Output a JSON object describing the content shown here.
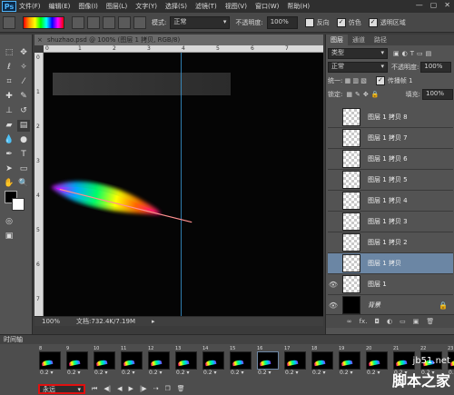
{
  "app": {
    "logo": "Ps"
  },
  "menu": [
    "文件(F)",
    "编辑(E)",
    "图像(I)",
    "图层(L)",
    "文字(Y)",
    "选择(S)",
    "滤镜(T)",
    "视图(V)",
    "窗口(W)",
    "帮助(H)"
  ],
  "window_controls": [
    "—",
    "▢",
    "✕"
  ],
  "options": {
    "mode_label": "模式:",
    "mode_value": "正常",
    "opacity_label": "不透明度:",
    "opacity_value": "100%",
    "reverse_label": "反向",
    "dither_label": "仿色",
    "transparency_label": "透明区域"
  },
  "document": {
    "title": "shuzhao.psd @ 100% (图层 1 拷贝, RGB/8)",
    "zoom": "100%",
    "doc_info": "文档:732.4K/7.19M",
    "ruler_top": [
      "0",
      "1",
      "2",
      "3",
      "4",
      "5",
      "6",
      "7"
    ],
    "ruler_left": [
      "0",
      "1",
      "2",
      "3",
      "4",
      "5",
      "6",
      "7"
    ]
  },
  "layers_panel": {
    "tabs": [
      "图层",
      "通道",
      "路径"
    ],
    "filter_label": "类型",
    "blend_mode": "正常",
    "opacity_label": "不透明度:",
    "opacity_value": "100%",
    "lock_label": "锁定:",
    "fill_label": "填充:",
    "fill_value": "100%",
    "propagate_label": "传播帧 1",
    "layers": [
      {
        "name": "图层 1 拷贝 8",
        "eye": "",
        "thumb": "transparent",
        "selected": false
      },
      {
        "name": "图层 1 拷贝 7",
        "eye": "",
        "thumb": "transparent",
        "selected": false
      },
      {
        "name": "图层 1 拷贝 6",
        "eye": "",
        "thumb": "transparent",
        "selected": false
      },
      {
        "name": "图层 1 拷贝 5",
        "eye": "",
        "thumb": "transparent",
        "selected": false
      },
      {
        "name": "图层 1 拷贝 4",
        "eye": "",
        "thumb": "transparent",
        "selected": false
      },
      {
        "name": "图层 1 拷贝 3",
        "eye": "",
        "thumb": "transparent",
        "selected": false
      },
      {
        "name": "图层 1 拷贝 2",
        "eye": "",
        "thumb": "transparent",
        "selected": false
      },
      {
        "name": "图层 1 拷贝",
        "eye": "",
        "thumb": "transparent",
        "selected": true
      },
      {
        "name": "图层 1",
        "eye": "👁",
        "thumb": "transparent",
        "selected": false
      },
      {
        "name": "背景",
        "eye": "👁",
        "thumb": "black",
        "selected": false,
        "lock": "🔒"
      }
    ],
    "footer_icons": [
      "∞",
      "fx.",
      "◘",
      "◐",
      "▭",
      "▣",
      "🗑"
    ]
  },
  "timeline": {
    "title": "时间轴",
    "frames": [
      {
        "num": "8",
        "delay": "0.2 ▾"
      },
      {
        "num": "9",
        "delay": "0.2 ▾"
      },
      {
        "num": "10",
        "delay": "0.2 ▾"
      },
      {
        "num": "11",
        "delay": "0.2 ▾"
      },
      {
        "num": "12",
        "delay": "0.2 ▾"
      },
      {
        "num": "13",
        "delay": "0.2 ▾"
      },
      {
        "num": "14",
        "delay": "0.2 ▾"
      },
      {
        "num": "15",
        "delay": "0.2 ▾"
      },
      {
        "num": "16",
        "delay": "0.2 ▾"
      },
      {
        "num": "17",
        "delay": "0.2 ▾"
      },
      {
        "num": "18",
        "delay": "0.2 ▾"
      },
      {
        "num": "19",
        "delay": "0.2 ▾"
      },
      {
        "num": "20",
        "delay": "0.2 ▾"
      },
      {
        "num": "21",
        "delay": "0.2 ▾"
      },
      {
        "num": "22",
        "delay": "0.2 ▾"
      },
      {
        "num": "23",
        "delay": "0.2 ▾"
      }
    ],
    "loop_value": "永远",
    "controls": [
      "⏮",
      "◀|",
      "◀",
      "▶",
      "|▶",
      "⇢",
      "❐",
      "🗑"
    ]
  },
  "watermark": {
    "line1": "jb51.net",
    "line2": "脚本之家"
  }
}
